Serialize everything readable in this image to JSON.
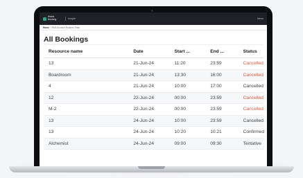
{
  "app": {
    "logo_text": "Matrix Booking",
    "app_name": "Insight",
    "menu": "Menu"
  },
  "breadcrumb": {
    "home": "Home",
    "path": "/ RMS Account Bookers Team"
  },
  "page": {
    "title": "All Bookings"
  },
  "table": {
    "headers": {
      "resource": "Resource name",
      "date": "Date",
      "start": "Start ...",
      "end": "End ...",
      "status": "Status"
    },
    "rows": [
      {
        "resource": "13",
        "date": "21-Jun-24",
        "start": "11:20",
        "end": "23:59",
        "status": "Cancelled"
      },
      {
        "resource": "Boardroom",
        "date": "21-Jun-24",
        "start": "13:30",
        "end": "16:00",
        "status": "Cancelled"
      },
      {
        "resource": "4",
        "date": "21-Jun-24",
        "start": "10:00",
        "end": "17:00",
        "status": "Cancelled"
      },
      {
        "resource": "12",
        "date": "22-Jun-24",
        "start": "00:00",
        "end": "23:59",
        "status": "Cancelled"
      },
      {
        "resource": "M-2",
        "date": "22-Jun-24",
        "start": "00:00",
        "end": "23:59",
        "status": "Cancelled"
      },
      {
        "resource": "13",
        "date": "24-Jun-24",
        "start": "10:00",
        "end": "23:59",
        "status": "Cancelled"
      },
      {
        "resource": "13",
        "date": "24-Jun-24",
        "start": "10:20",
        "end": "10:21",
        "status": "Confirmed"
      },
      {
        "resource": "Alchemist",
        "date": "24-Jun-24",
        "start": "09:00",
        "end": "09:30",
        "status": "Tentative"
      }
    ]
  },
  "colors": {
    "accent": "#2aa58a",
    "cancelled": "#e0583b",
    "cancelled_alt": "#3c4047"
  }
}
